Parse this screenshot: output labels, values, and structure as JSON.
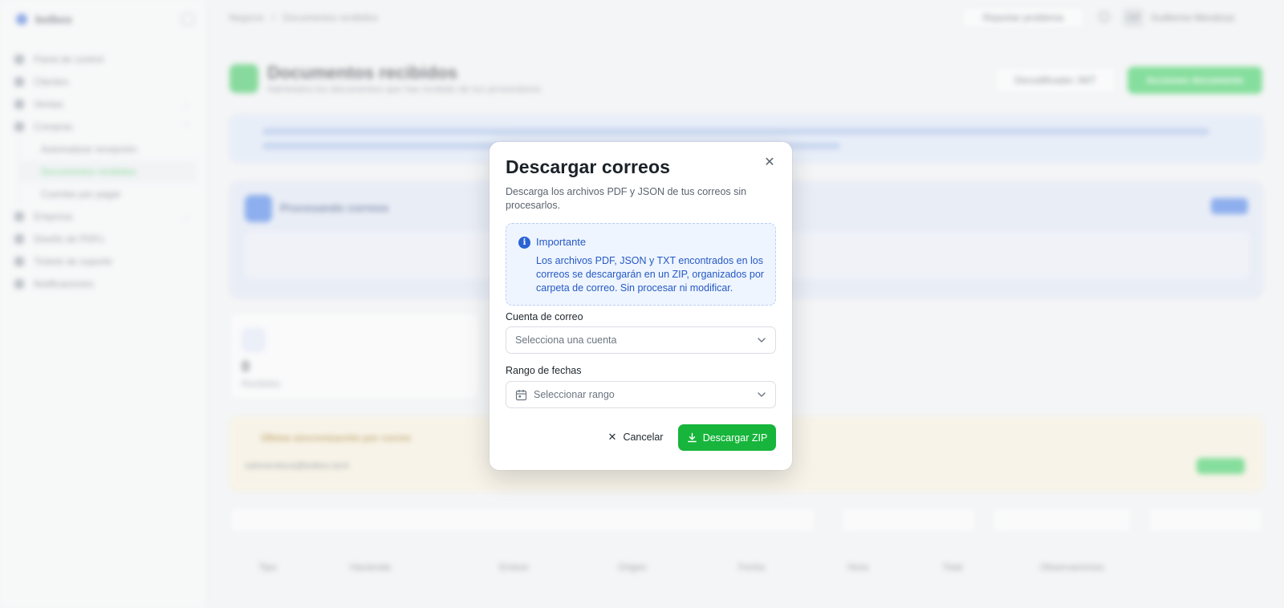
{
  "background": {
    "brand": "bolbox",
    "breadcrumb": [
      "Negocio",
      "/",
      "Documentos recibidos"
    ],
    "nav": [
      {
        "label": "Panel de control",
        "type": "item"
      },
      {
        "label": "Clientes",
        "type": "item"
      },
      {
        "label": "Ventas",
        "type": "item",
        "chevron": true
      },
      {
        "label": "Compras",
        "type": "item",
        "chevron": true
      },
      {
        "label": "Automatizar recepción",
        "type": "sub"
      },
      {
        "label": "Documentos recibidos",
        "type": "sub",
        "active": true
      },
      {
        "label": "Cuentas por pagar",
        "type": "sub"
      },
      {
        "label": "Empresa",
        "type": "item",
        "chevron": true
      },
      {
        "label": "Diseño de PDFs",
        "type": "item"
      },
      {
        "label": "Tickets de soporte",
        "type": "item"
      },
      {
        "label": "Notificaciones",
        "type": "item"
      }
    ],
    "report_button": "Reportar problema",
    "user_initials": "GM",
    "user_name": "Guillermo Mendoza",
    "page_title": "Documentos recibidos",
    "page_subtitle": "Administra los documentos que has recibido de tus proveedores",
    "jwt_button": "Decodificador JWT",
    "actions_button": "Acciones documento",
    "processing_title": "Procesando correos",
    "stat_value": "0",
    "stat_label": "Recibidos",
    "warning_title": "Última sincronización por correo",
    "warning_email": "sebmendoza@bolbox.tech",
    "table_headers": [
      "Tipo",
      "Hacienda",
      "Emisor",
      "Origen",
      "Fecha",
      "Hora",
      "Total",
      "Observaciones"
    ]
  },
  "modal": {
    "title": "Descargar correos",
    "description": "Descarga los archivos PDF y JSON de tus correos sin procesarlos.",
    "alert": {
      "title": "Importante",
      "body": "Los archivos PDF, JSON y TXT encontrados en los correos se descargarán en un ZIP, organizados por carpeta de correo. Sin procesar ni modificar."
    },
    "account_label": "Cuenta de correo",
    "account_placeholder": "Selecciona una cuenta",
    "range_label": "Rango de fechas",
    "range_placeholder": "Seleccionar rango",
    "cancel_label": "Cancelar",
    "download_label": "Descargar ZIP"
  },
  "colors": {
    "primary_green": "#17b53b",
    "info_blue": "#2459c4",
    "alert_bg": "#eff5ff"
  }
}
